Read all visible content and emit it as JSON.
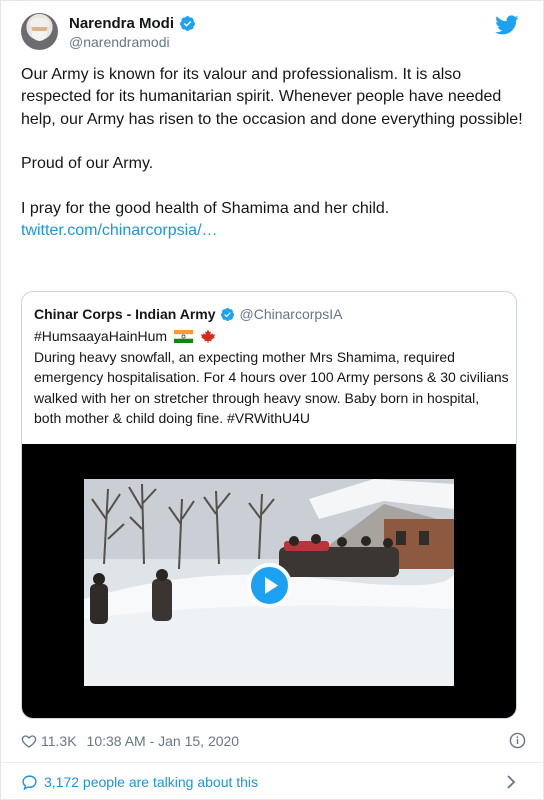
{
  "author": {
    "display_name": "Narendra Modi",
    "handle": "@narendramodi",
    "verified": true
  },
  "tweet": {
    "paragraphs": [
      "Our Army is known for its valour and professionalism. It is also respected for its humanitarian spirit. Whenever people have needed help, our Army has risen to the occasion and done everything possible!",
      "Proud of our Army.",
      "I pray for the good health of Shamima and her child."
    ],
    "link": "twitter.com/chinarcorpsia/…"
  },
  "quoted": {
    "display_name": "Chinar Corps - Indian Army",
    "handle": "@ChinarcorpsIA",
    "hashtag": "#HumsaayaHainHum",
    "body": "During heavy snowfall, an expecting mother Mrs Shamima, required emergency hospitalisation. For 4 hours over 100 Army persons & 30 civilians walked with her on stretcher through heavy snow. Baby born in hospital, both mother & child doing fine. #VRWithU4U"
  },
  "footer": {
    "likes": "11.3K",
    "timestamp": "10:38 AM - Jan 15, 2020",
    "talking": "3,172 people are talking about this"
  },
  "icons": {
    "verified": "verified-badge-icon",
    "twitter": "twitter-bird-icon",
    "play": "play-icon",
    "heart": "heart-icon",
    "info": "info-icon",
    "comment": "comment-bubble-icon",
    "chevron": "chevron-right-icon"
  },
  "colors": {
    "accent": "#1da1f2",
    "link": "#1b95e0",
    "secondary_text": "#657786"
  }
}
